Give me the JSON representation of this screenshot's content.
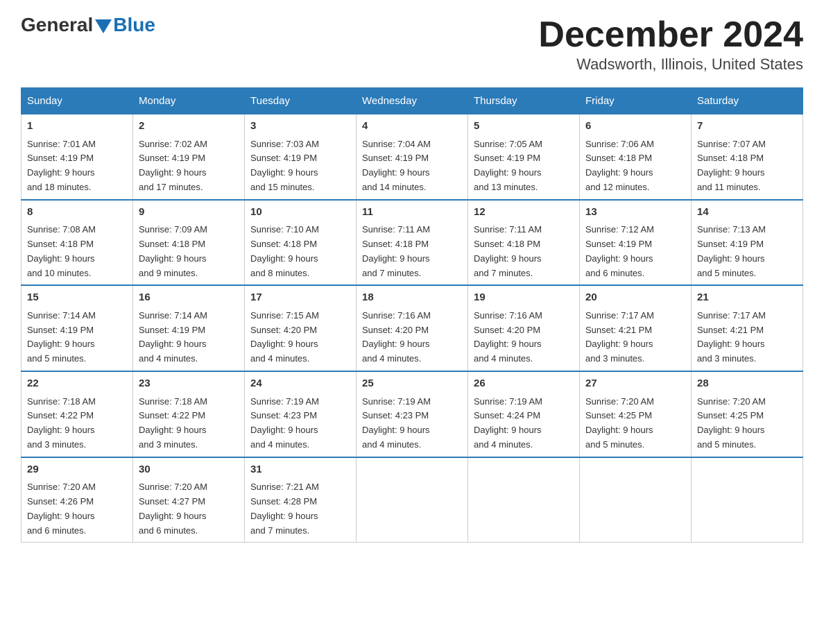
{
  "header": {
    "logo_general": "General",
    "logo_blue": "Blue",
    "month_title": "December 2024",
    "location": "Wadsworth, Illinois, United States"
  },
  "days_of_week": [
    "Sunday",
    "Monday",
    "Tuesday",
    "Wednesday",
    "Thursday",
    "Friday",
    "Saturday"
  ],
  "weeks": [
    [
      {
        "day": "1",
        "sunrise": "7:01 AM",
        "sunset": "4:19 PM",
        "daylight": "9 hours and 18 minutes."
      },
      {
        "day": "2",
        "sunrise": "7:02 AM",
        "sunset": "4:19 PM",
        "daylight": "9 hours and 17 minutes."
      },
      {
        "day": "3",
        "sunrise": "7:03 AM",
        "sunset": "4:19 PM",
        "daylight": "9 hours and 15 minutes."
      },
      {
        "day": "4",
        "sunrise": "7:04 AM",
        "sunset": "4:19 PM",
        "daylight": "9 hours and 14 minutes."
      },
      {
        "day": "5",
        "sunrise": "7:05 AM",
        "sunset": "4:19 PM",
        "daylight": "9 hours and 13 minutes."
      },
      {
        "day": "6",
        "sunrise": "7:06 AM",
        "sunset": "4:18 PM",
        "daylight": "9 hours and 12 minutes."
      },
      {
        "day": "7",
        "sunrise": "7:07 AM",
        "sunset": "4:18 PM",
        "daylight": "9 hours and 11 minutes."
      }
    ],
    [
      {
        "day": "8",
        "sunrise": "7:08 AM",
        "sunset": "4:18 PM",
        "daylight": "9 hours and 10 minutes."
      },
      {
        "day": "9",
        "sunrise": "7:09 AM",
        "sunset": "4:18 PM",
        "daylight": "9 hours and 9 minutes."
      },
      {
        "day": "10",
        "sunrise": "7:10 AM",
        "sunset": "4:18 PM",
        "daylight": "9 hours and 8 minutes."
      },
      {
        "day": "11",
        "sunrise": "7:11 AM",
        "sunset": "4:18 PM",
        "daylight": "9 hours and 7 minutes."
      },
      {
        "day": "12",
        "sunrise": "7:11 AM",
        "sunset": "4:18 PM",
        "daylight": "9 hours and 7 minutes."
      },
      {
        "day": "13",
        "sunrise": "7:12 AM",
        "sunset": "4:19 PM",
        "daylight": "9 hours and 6 minutes."
      },
      {
        "day": "14",
        "sunrise": "7:13 AM",
        "sunset": "4:19 PM",
        "daylight": "9 hours and 5 minutes."
      }
    ],
    [
      {
        "day": "15",
        "sunrise": "7:14 AM",
        "sunset": "4:19 PM",
        "daylight": "9 hours and 5 minutes."
      },
      {
        "day": "16",
        "sunrise": "7:14 AM",
        "sunset": "4:19 PM",
        "daylight": "9 hours and 4 minutes."
      },
      {
        "day": "17",
        "sunrise": "7:15 AM",
        "sunset": "4:20 PM",
        "daylight": "9 hours and 4 minutes."
      },
      {
        "day": "18",
        "sunrise": "7:16 AM",
        "sunset": "4:20 PM",
        "daylight": "9 hours and 4 minutes."
      },
      {
        "day": "19",
        "sunrise": "7:16 AM",
        "sunset": "4:20 PM",
        "daylight": "9 hours and 4 minutes."
      },
      {
        "day": "20",
        "sunrise": "7:17 AM",
        "sunset": "4:21 PM",
        "daylight": "9 hours and 3 minutes."
      },
      {
        "day": "21",
        "sunrise": "7:17 AM",
        "sunset": "4:21 PM",
        "daylight": "9 hours and 3 minutes."
      }
    ],
    [
      {
        "day": "22",
        "sunrise": "7:18 AM",
        "sunset": "4:22 PM",
        "daylight": "9 hours and 3 minutes."
      },
      {
        "day": "23",
        "sunrise": "7:18 AM",
        "sunset": "4:22 PM",
        "daylight": "9 hours and 3 minutes."
      },
      {
        "day": "24",
        "sunrise": "7:19 AM",
        "sunset": "4:23 PM",
        "daylight": "9 hours and 4 minutes."
      },
      {
        "day": "25",
        "sunrise": "7:19 AM",
        "sunset": "4:23 PM",
        "daylight": "9 hours and 4 minutes."
      },
      {
        "day": "26",
        "sunrise": "7:19 AM",
        "sunset": "4:24 PM",
        "daylight": "9 hours and 4 minutes."
      },
      {
        "day": "27",
        "sunrise": "7:20 AM",
        "sunset": "4:25 PM",
        "daylight": "9 hours and 5 minutes."
      },
      {
        "day": "28",
        "sunrise": "7:20 AM",
        "sunset": "4:25 PM",
        "daylight": "9 hours and 5 minutes."
      }
    ],
    [
      {
        "day": "29",
        "sunrise": "7:20 AM",
        "sunset": "4:26 PM",
        "daylight": "9 hours and 6 minutes."
      },
      {
        "day": "30",
        "sunrise": "7:20 AM",
        "sunset": "4:27 PM",
        "daylight": "9 hours and 6 minutes."
      },
      {
        "day": "31",
        "sunrise": "7:21 AM",
        "sunset": "4:28 PM",
        "daylight": "9 hours and 7 minutes."
      },
      null,
      null,
      null,
      null
    ]
  ],
  "labels": {
    "sunrise": "Sunrise:",
    "sunset": "Sunset:",
    "daylight": "Daylight:"
  }
}
